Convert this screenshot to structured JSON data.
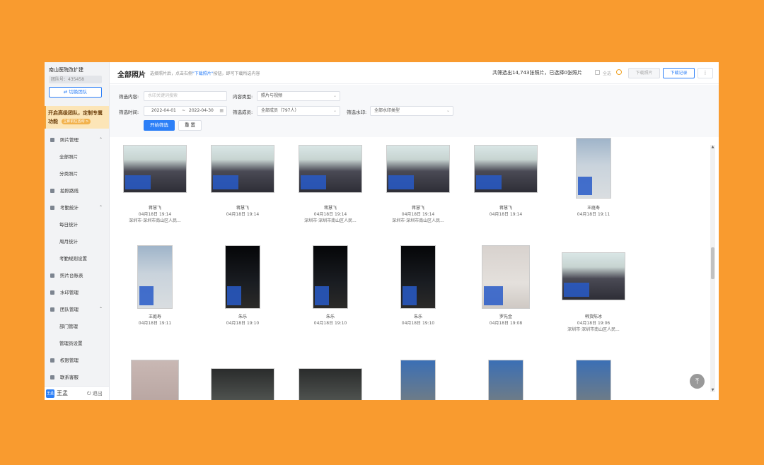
{
  "sidebar": {
    "team_name": "南山医院改扩建",
    "team_id": "团队号：435458",
    "switch_label": "⇄ 切换团队",
    "promo_text": "开启高级团队，定制专属功能",
    "promo_link": "立即前往咨询 >",
    "nav": [
      {
        "label": "照片管理",
        "type": "group",
        "icon": "photo-icon",
        "caret": "⌃"
      },
      {
        "label": "全部照片",
        "type": "sub"
      },
      {
        "label": "分类照片",
        "type": "sub"
      },
      {
        "label": "拍照路线",
        "type": "group",
        "icon": "route-icon"
      },
      {
        "label": "考勤统计",
        "type": "group",
        "icon": "calendar-icon",
        "caret": "⌃"
      },
      {
        "label": "每日统计",
        "type": "sub"
      },
      {
        "label": "周月统计",
        "type": "sub"
      },
      {
        "label": "考勤规则设置",
        "type": "sub"
      },
      {
        "label": "照片台账表",
        "type": "group",
        "icon": "table-icon"
      },
      {
        "label": "水印管理",
        "type": "group",
        "icon": "watermark-icon"
      },
      {
        "label": "团队管理",
        "type": "group",
        "icon": "team-icon",
        "caret": "⌃"
      },
      {
        "label": "部门管理",
        "type": "sub"
      },
      {
        "label": "管理员设置",
        "type": "sub"
      },
      {
        "label": "权限管理",
        "type": "group",
        "icon": "permission-icon"
      },
      {
        "label": "联系客服",
        "type": "group",
        "icon": "service-icon"
      }
    ],
    "avatar_text": "王孟",
    "user_name": "王孟",
    "logout": "⏻ 退出"
  },
  "header": {
    "title": "全部照片",
    "hint_prefix": "选择照片后，点击右侧",
    "hint_link": "\"下载照片\"",
    "hint_suffix": "按钮，即可下载所选内容",
    "summary": "共筛选出14,743张照片，已选择0张照片",
    "select_all": "全选",
    "download_label": "下载照片",
    "records_label": "下载记录",
    "more_label": "⋮"
  },
  "filters": {
    "content_label": "筛选内容:",
    "content_placeholder": "水印关键词搜索",
    "type_label": "内容类型:",
    "type_value": "照片与视频",
    "time_label": "筛选时间:",
    "date_start": "2022-04-01",
    "date_sep": "~",
    "date_end": "2022-04-30",
    "member_label": "筛选成员:",
    "member_value": "全部成员（797人）",
    "watermark_label": "筛选水印:",
    "watermark_value": "全部水印类型",
    "start_label": "开始筛选",
    "reset_label": "重 置"
  },
  "photos": [
    {
      "name": "蒋慧飞",
      "time": "04月18日 19:14",
      "loc": "深圳市·深圳市南山区人民..."
    },
    {
      "name": "蒋慧飞",
      "time": "04月18日 19:14",
      "loc": ""
    },
    {
      "name": "蒋慧飞",
      "time": "04月18日 19:14",
      "loc": "深圳市·深圳市南山区人民..."
    },
    {
      "name": "蒋慧飞",
      "time": "04月18日 19:14",
      "loc": "深圳市·深圳市南山区人民..."
    },
    {
      "name": "蒋慧飞",
      "time": "04月18日 19:14",
      "loc": ""
    },
    {
      "name": "王庭寿",
      "time": "04月18日 19:11",
      "loc": ""
    },
    {
      "name": "王庭寿",
      "time": "04月18日 19:11",
      "loc": ""
    },
    {
      "name": "朱乐",
      "time": "04月18日 19:10",
      "loc": ""
    },
    {
      "name": "朱乐",
      "time": "04月18日 19:10",
      "loc": ""
    },
    {
      "name": "朱乐",
      "time": "04月18日 19:10",
      "loc": ""
    },
    {
      "name": "罗先金",
      "time": "04月18日 19:08",
      "loc": ""
    },
    {
      "name": "韩货陈冰",
      "time": "04月18日 19:06",
      "loc": "深圳市·深圳市南山区人民..."
    }
  ],
  "colors": {
    "background": "#F99B2F",
    "accent": "#2C7FF7",
    "promo_bg": "#FCE5B7"
  }
}
